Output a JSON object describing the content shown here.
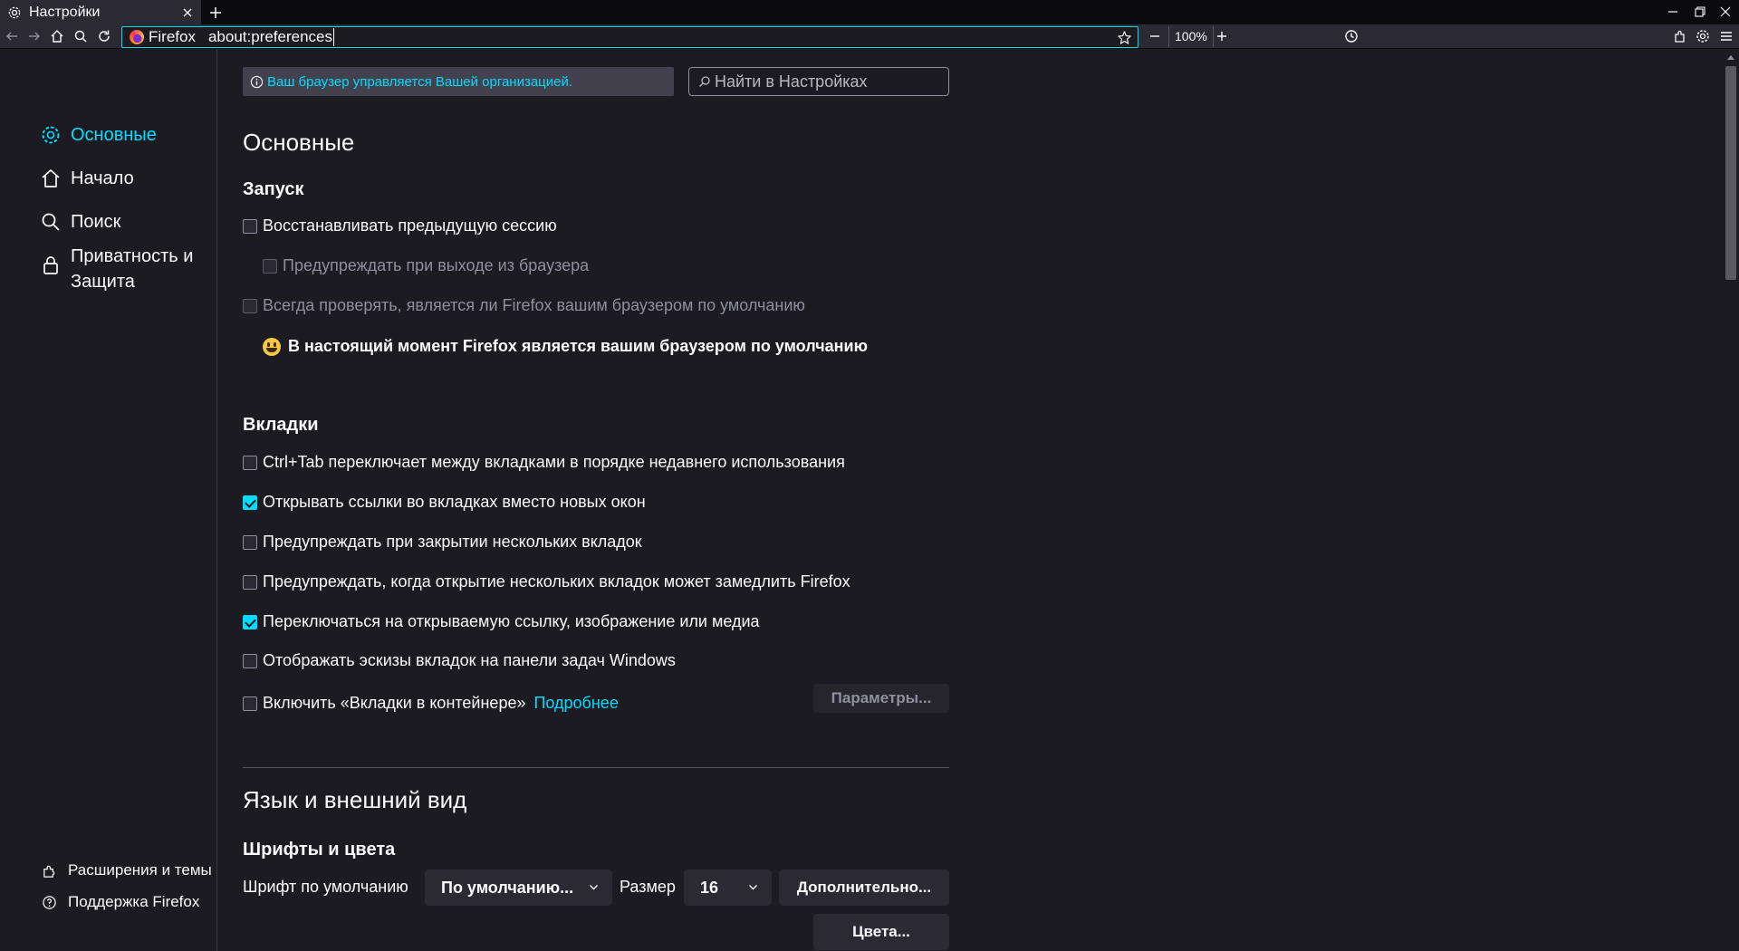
{
  "window": {
    "tab_title": "Настройки",
    "url_identity": "Firefox",
    "url": "about:preferences",
    "zoom": "100%"
  },
  "sidebar": {
    "categories": [
      {
        "label": "Основные",
        "icon": "gear-icon",
        "selected": true
      },
      {
        "label": "Начало",
        "icon": "home-icon",
        "selected": false
      },
      {
        "label": "Поиск",
        "icon": "search-icon",
        "selected": false
      },
      {
        "label": "Приватность и Защита",
        "icon": "lock-icon",
        "selected": false
      }
    ],
    "footer": [
      {
        "label": "Расширения и темы",
        "icon": "extension-icon"
      },
      {
        "label": "Поддержка Firefox",
        "icon": "help-icon"
      }
    ]
  },
  "main": {
    "policy_notice": "Ваш браузер управляется Вашей организацией.",
    "search_placeholder": "Найти в Настройках",
    "general_heading": "Основные",
    "startup": {
      "heading": "Запуск",
      "restore_session": "Восстанавливать предыдущую сессию",
      "warn_on_quit": "Предупреждать при выходе из браузера",
      "always_check_default": "Всегда проверять, является ли Firefox вашим браузером по умолчанию",
      "default_message": "В настоящий момент Firefox является вашим браузером по умолчанию"
    },
    "tabs": {
      "heading": "Вкладки",
      "items": [
        {
          "label": "Ctrl+Tab переключает между вкладками в порядке недавнего использования",
          "checked": false
        },
        {
          "label": "Открывать ссылки во вкладках вместо новых окон",
          "checked": true
        },
        {
          "label": "Предупреждать при закрытии нескольких вкладок",
          "checked": false
        },
        {
          "label": "Предупреждать, когда открытие нескольких вкладок может замедлить Firefox",
          "checked": false
        },
        {
          "label": "Переключаться на открываемую ссылку, изображение или медиа",
          "checked": true
        },
        {
          "label": "Отображать эскизы вкладок на панели задач Windows",
          "checked": false
        }
      ],
      "containers_label": "Включить «Вкладки в контейнере»",
      "containers_link": "Подробнее",
      "containers_settings": "Параметры..."
    },
    "language": {
      "heading": "Язык и внешний вид",
      "fonts_heading": "Шрифты и цвета",
      "default_font_label": "Шрифт по умолчанию",
      "default_font_value": "По умолчанию...",
      "size_label": "Размер",
      "size_value": "16",
      "advanced_button": "Дополнительно...",
      "colors_button": "Цвета..."
    }
  },
  "colors": {
    "accent": "#00ddff",
    "background": "#1c1b22",
    "toolbar": "#2b2a33"
  }
}
